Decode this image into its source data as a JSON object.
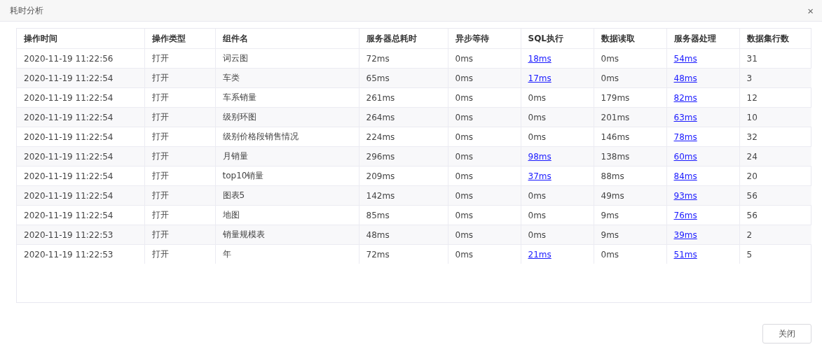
{
  "window": {
    "title": "耗时分析",
    "close": "×"
  },
  "table": {
    "columns": [
      "操作时间",
      "操作类型",
      "组件名",
      "服务器总耗时",
      "异步等待",
      "SQL执行",
      "数据读取",
      "服务器处理",
      "数据集行数"
    ],
    "rows": [
      [
        {
          "text": "2020-11-19 11:22:56",
          "kind": "text"
        },
        {
          "text": "打开",
          "kind": "text"
        },
        {
          "text": "词云图",
          "kind": "text"
        },
        {
          "text": "72ms",
          "kind": "text"
        },
        {
          "text": "0ms",
          "kind": "text"
        },
        {
          "text": "18ms",
          "kind": "link"
        },
        {
          "text": "0ms",
          "kind": "text"
        },
        {
          "text": "54ms",
          "kind": "link"
        },
        {
          "text": "31",
          "kind": "text"
        }
      ],
      [
        {
          "text": "2020-11-19 11:22:54",
          "kind": "text"
        },
        {
          "text": "打开",
          "kind": "text"
        },
        {
          "text": "车类",
          "kind": "text"
        },
        {
          "text": "65ms",
          "kind": "text"
        },
        {
          "text": "0ms",
          "kind": "text"
        },
        {
          "text": "17ms",
          "kind": "link"
        },
        {
          "text": "0ms",
          "kind": "text"
        },
        {
          "text": "48ms",
          "kind": "link"
        },
        {
          "text": "3",
          "kind": "text"
        }
      ],
      [
        {
          "text": "2020-11-19 11:22:54",
          "kind": "text"
        },
        {
          "text": "打开",
          "kind": "text"
        },
        {
          "text": "车系销量",
          "kind": "text"
        },
        {
          "text": "261ms",
          "kind": "text"
        },
        {
          "text": "0ms",
          "kind": "text"
        },
        {
          "text": "0ms",
          "kind": "text"
        },
        {
          "text": "179ms",
          "kind": "text"
        },
        {
          "text": "82ms",
          "kind": "link"
        },
        {
          "text": "12",
          "kind": "text"
        }
      ],
      [
        {
          "text": "2020-11-19 11:22:54",
          "kind": "text"
        },
        {
          "text": "打开",
          "kind": "text"
        },
        {
          "text": "级别环图",
          "kind": "text"
        },
        {
          "text": "264ms",
          "kind": "text"
        },
        {
          "text": "0ms",
          "kind": "text"
        },
        {
          "text": "0ms",
          "kind": "text"
        },
        {
          "text": "201ms",
          "kind": "text"
        },
        {
          "text": "63ms",
          "kind": "link"
        },
        {
          "text": "10",
          "kind": "text"
        }
      ],
      [
        {
          "text": "2020-11-19 11:22:54",
          "kind": "text"
        },
        {
          "text": "打开",
          "kind": "text"
        },
        {
          "text": "级别价格段销售情况",
          "kind": "text"
        },
        {
          "text": "224ms",
          "kind": "text"
        },
        {
          "text": "0ms",
          "kind": "text"
        },
        {
          "text": "0ms",
          "kind": "text"
        },
        {
          "text": "146ms",
          "kind": "text"
        },
        {
          "text": "78ms",
          "kind": "link"
        },
        {
          "text": "32",
          "kind": "text"
        }
      ],
      [
        {
          "text": "2020-11-19 11:22:54",
          "kind": "text"
        },
        {
          "text": "打开",
          "kind": "text"
        },
        {
          "text": "月销量",
          "kind": "text"
        },
        {
          "text": "296ms",
          "kind": "text"
        },
        {
          "text": "0ms",
          "kind": "text"
        },
        {
          "text": "98ms",
          "kind": "link"
        },
        {
          "text": "138ms",
          "kind": "text"
        },
        {
          "text": "60ms",
          "kind": "link"
        },
        {
          "text": "24",
          "kind": "text"
        }
      ],
      [
        {
          "text": "2020-11-19 11:22:54",
          "kind": "text"
        },
        {
          "text": "打开",
          "kind": "text"
        },
        {
          "text": "top10销量",
          "kind": "text"
        },
        {
          "text": "209ms",
          "kind": "text"
        },
        {
          "text": "0ms",
          "kind": "text"
        },
        {
          "text": "37ms",
          "kind": "link"
        },
        {
          "text": "88ms",
          "kind": "text"
        },
        {
          "text": "84ms",
          "kind": "link"
        },
        {
          "text": "20",
          "kind": "text"
        }
      ],
      [
        {
          "text": "2020-11-19 11:22:54",
          "kind": "text"
        },
        {
          "text": "打开",
          "kind": "text"
        },
        {
          "text": "图表5",
          "kind": "text"
        },
        {
          "text": "142ms",
          "kind": "text"
        },
        {
          "text": "0ms",
          "kind": "text"
        },
        {
          "text": "0ms",
          "kind": "text"
        },
        {
          "text": "49ms",
          "kind": "text"
        },
        {
          "text": "93ms",
          "kind": "link"
        },
        {
          "text": "56",
          "kind": "text"
        }
      ],
      [
        {
          "text": "2020-11-19 11:22:54",
          "kind": "text"
        },
        {
          "text": "打开",
          "kind": "text"
        },
        {
          "text": "地图",
          "kind": "text"
        },
        {
          "text": "85ms",
          "kind": "text"
        },
        {
          "text": "0ms",
          "kind": "text"
        },
        {
          "text": "0ms",
          "kind": "text"
        },
        {
          "text": "9ms",
          "kind": "text"
        },
        {
          "text": "76ms",
          "kind": "link"
        },
        {
          "text": "56",
          "kind": "text"
        }
      ],
      [
        {
          "text": "2020-11-19 11:22:53",
          "kind": "text"
        },
        {
          "text": "打开",
          "kind": "text"
        },
        {
          "text": "销量规模表",
          "kind": "text"
        },
        {
          "text": "48ms",
          "kind": "text"
        },
        {
          "text": "0ms",
          "kind": "text"
        },
        {
          "text": "0ms",
          "kind": "text"
        },
        {
          "text": "9ms",
          "kind": "text"
        },
        {
          "text": "39ms",
          "kind": "link"
        },
        {
          "text": "2",
          "kind": "text"
        }
      ],
      [
        {
          "text": "2020-11-19 11:22:53",
          "kind": "text"
        },
        {
          "text": "打开",
          "kind": "text"
        },
        {
          "text": "年",
          "kind": "text"
        },
        {
          "text": "72ms",
          "kind": "text"
        },
        {
          "text": "0ms",
          "kind": "text"
        },
        {
          "text": "21ms",
          "kind": "link"
        },
        {
          "text": "0ms",
          "kind": "text"
        },
        {
          "text": "51ms",
          "kind": "link"
        },
        {
          "text": "5",
          "kind": "text"
        }
      ]
    ]
  },
  "buttons": [
    "关闭"
  ]
}
